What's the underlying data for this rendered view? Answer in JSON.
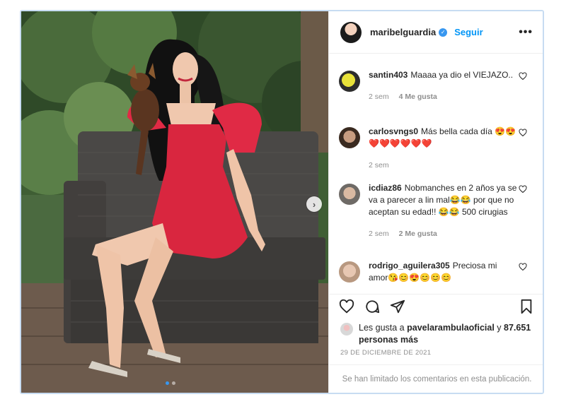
{
  "post": {
    "author": "maribelguardia",
    "follow_label": "Seguir",
    "more_label": "•••",
    "verified_mark": "✓"
  },
  "comments": [
    {
      "user": "santin403",
      "text": "Maaaa ya dio el VIEJAZO..",
      "time": "2 sem",
      "likes": "4 Me gusta",
      "avatar_color": "#d4c21a"
    },
    {
      "user": "carlosvngs0",
      "text": "Más bella cada día 😍😍❤️❤️❤️❤️❤️❤️",
      "time": "2 sem",
      "likes": "",
      "avatar_color": "#6b4a3a"
    },
    {
      "user": "icdiaz86",
      "text": "Nobmanches en 2 años ya se va a parecer a lin mal😂😂 por que no aceptan su edad!! 😂😂 500 cirugias",
      "time": "2 sem",
      "likes": "2 Me gusta",
      "avatar_color": "#8a7b70"
    },
    {
      "user": "rodrigo_aguilera305",
      "text": "Preciosa mi amor😘😊😍😊😊😊",
      "time": "",
      "likes": "",
      "avatar_color": "#c9a58a"
    }
  ],
  "likes": {
    "prefix": "Les gusta a",
    "user": "pavelarambulaoficial",
    "connector": "y",
    "count": "87.651 personas más"
  },
  "date": "29 DE DICIEMBRE DE 2021",
  "limited_notice": "Se han limitado los comentarios en esta publicación.",
  "icons": [
    "heart-icon",
    "comment-icon",
    "share-icon",
    "bookmark-icon"
  ],
  "colors": {
    "accent": "#0095f6",
    "dress": "#d9263f",
    "muted": "#8e8e8e"
  }
}
